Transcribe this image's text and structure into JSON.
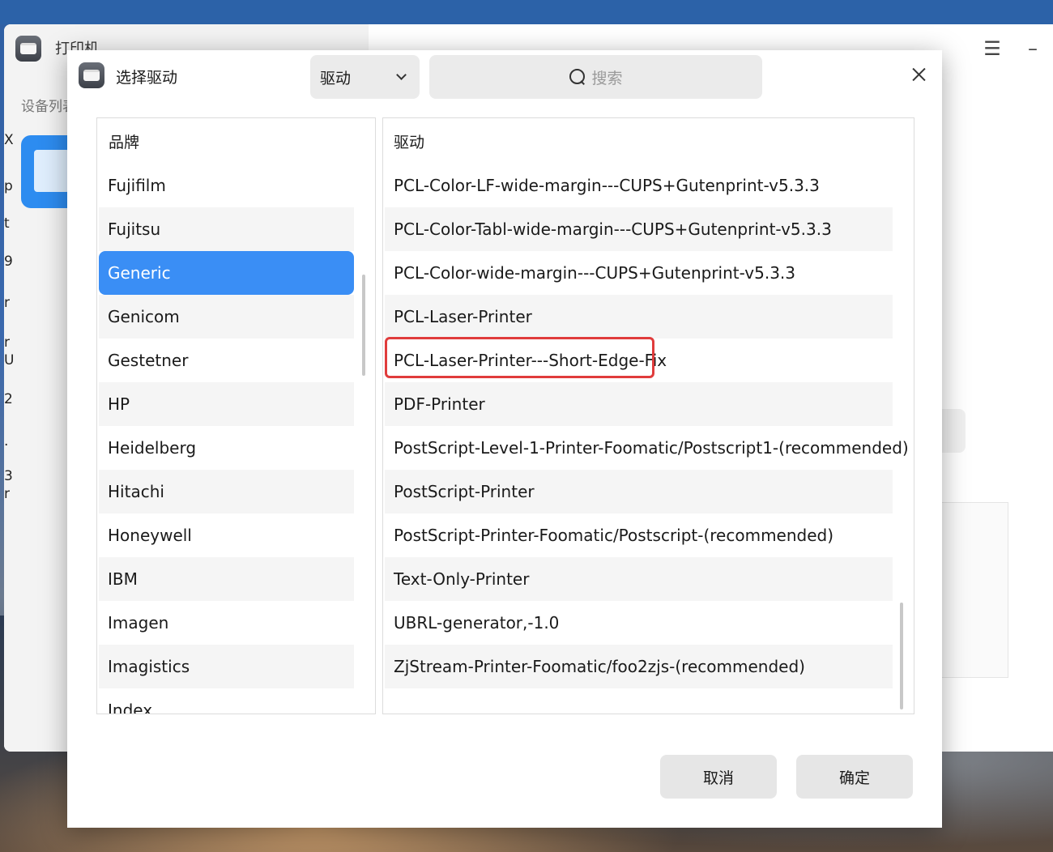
{
  "main_window": {
    "title": "打印机",
    "device_list_label": "设备列表",
    "edge_fragments": [
      "X",
      "p",
      "t",
      "9",
      "r",
      "r",
      "U",
      "2",
      ".",
      "3",
      "r"
    ],
    "menu_icon": "hamburger-icon",
    "minimize_icon": "minimize-icon"
  },
  "dialog": {
    "title": "选择驱动",
    "filter_value": "驱动",
    "search_placeholder": "搜索",
    "brand_header": "品牌",
    "driver_header": "驱动",
    "brands": [
      "Fujifilm",
      "Fujitsu",
      "Generic",
      "Genicom",
      "Gestetner",
      "HP",
      "Heidelberg",
      "Hitachi",
      "Honeywell",
      "IBM",
      "Imagen",
      "Imagistics",
      "Index"
    ],
    "selected_brand": "Generic",
    "drivers": [
      "PCL-Color-LF-wide-margin---CUPS+Gutenprint-v5.3.3",
      "PCL-Color-Tabl-wide-margin---CUPS+Gutenprint-v5.3.3",
      "PCL-Color-wide-margin---CUPS+Gutenprint-v5.3.3",
      "PCL-Laser-Printer",
      "PCL-Laser-Printer---Short-Edge-Fix",
      "PDF-Printer",
      "PostScript-Level-1-Printer-Foomatic/Postscript1-(recommended)",
      "PostScript-Printer",
      "PostScript-Printer-Foomatic/Postscript-(recommended)",
      "Text-Only-Printer",
      "UBRL-generator,-1.0",
      "ZjStream-Printer-Foomatic/foo2zjs-(recommended)"
    ],
    "highlighted_driver": "PCL-Laser-Printer---Short-Edge-Fix",
    "cancel_label": "取消",
    "ok_label": "确定"
  },
  "colors": {
    "accent": "#3a8ef5",
    "highlight_border": "#e03c3c"
  }
}
